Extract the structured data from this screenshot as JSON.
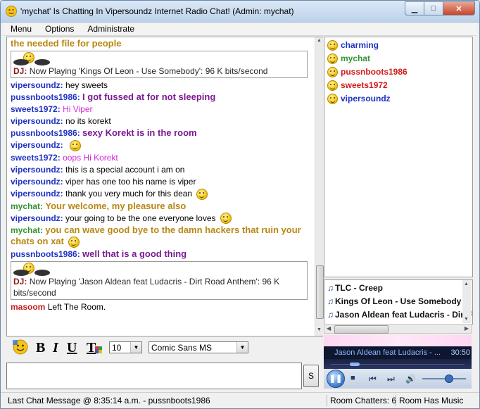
{
  "window": {
    "title": "'mychat' Is Chatting In Vipersoundz Internet Radio Chat!   (Admin: mychat)",
    "controls": {
      "minimize": "▁",
      "maximize": "□",
      "close": "✕"
    }
  },
  "menu": [
    "Menu",
    "Options",
    "Administrate"
  ],
  "chat": {
    "messages": [
      {
        "text": "the needed file for people",
        "style": "gold"
      },
      {
        "dj": true,
        "label": "DJ:",
        "text": "Now Playing 'Kings Of Leon - Use Somebody': 96 K bits/second"
      },
      {
        "user": "vipersoundz:",
        "text": "hey sweets",
        "ucolor": "blue",
        "tstyle": "plain"
      },
      {
        "user": "pussnboots1986:",
        "text": "I got fussed at for not sleeping",
        "ucolor": "blue",
        "tstyle": "purple"
      },
      {
        "user": "sweets1972:",
        "text": "Hi Viper",
        "ucolor": "blue",
        "tstyle": "pink"
      },
      {
        "user": "vipersoundz:",
        "text": "no its korekt",
        "ucolor": "blue",
        "tstyle": "plain"
      },
      {
        "user": "pussnboots1986:",
        "text": "sexy Korekt is in the room",
        "ucolor": "blue",
        "tstyle": "purple"
      },
      {
        "user": "vipersoundz:",
        "text": "",
        "ucolor": "blue",
        "tstyle": "plain",
        "smiley": true
      },
      {
        "user": "sweets1972:",
        "text": "oops Hi Korekt",
        "ucolor": "blue",
        "tstyle": "pink"
      },
      {
        "user": "vipersoundz:",
        "text": "this is a special account i am on",
        "ucolor": "blue",
        "tstyle": "plain"
      },
      {
        "user": "vipersoundz:",
        "text": "viper has one too his name is viper",
        "ucolor": "blue",
        "tstyle": "plain"
      },
      {
        "user": "vipersoundz:",
        "text": "thank you very much for this dean",
        "ucolor": "blue",
        "tstyle": "plain",
        "smiley": true
      },
      {
        "user": "mychat:",
        "text": "Your welcome, my pleasure also",
        "ucolor": "green",
        "tstyle": "gold"
      },
      {
        "user": "vipersoundz:",
        "text": "your going to be the one everyone loves",
        "ucolor": "blue",
        "tstyle": "plain",
        "smiley": true
      },
      {
        "user": "mychat:",
        "text": "you can wave good bye to the damn hackers that ruin your chats on xat",
        "ucolor": "green",
        "tstyle": "gold",
        "smiley": true
      },
      {
        "user": "pussnboots1986:",
        "text": "well that is a good thing",
        "ucolor": "blue",
        "tstyle": "purple"
      },
      {
        "dj": true,
        "label": "DJ:",
        "text": "Now Playing 'Jason Aldean feat Ludacris - Dirt Road Anthem': 96 K bits/second"
      },
      {
        "user": "masoom",
        "text": "Left The Room.",
        "ucolor": "red",
        "tstyle": "plain"
      }
    ]
  },
  "toolbar": {
    "bold": "B",
    "italic": "I",
    "underline": "U",
    "text_color": "T",
    "font_size": "10",
    "font_family": "Comic Sans MS"
  },
  "input": {
    "send_label": "S"
  },
  "users": [
    {
      "name": "charming",
      "color": "#1f32c1"
    },
    {
      "name": "mychat",
      "color": "#33932f"
    },
    {
      "name": "pussnboots1986",
      "color": "#d11b1b"
    },
    {
      "name": "sweets1972",
      "color": "#d11b1b"
    },
    {
      "name": "vipersoundz",
      "color": "#1f32c1"
    }
  ],
  "music": {
    "tracks": [
      "TLC - Creep",
      "Kings Of Leon - Use Somebody",
      "Jason Aldean feat Ludacris - Dirt Road Anthem"
    ],
    "now_playing": "Jason Aldean feat Ludacris - ...",
    "time": "30:50",
    "seek_fraction": 0.18,
    "volume_fraction": 0.6
  },
  "status": {
    "last_message": "Last Chat Message @ 8:35:14 a.m. - pussnboots1986",
    "room_chatters": "Room Chatters: 6",
    "room_music": "Room Has Music"
  }
}
